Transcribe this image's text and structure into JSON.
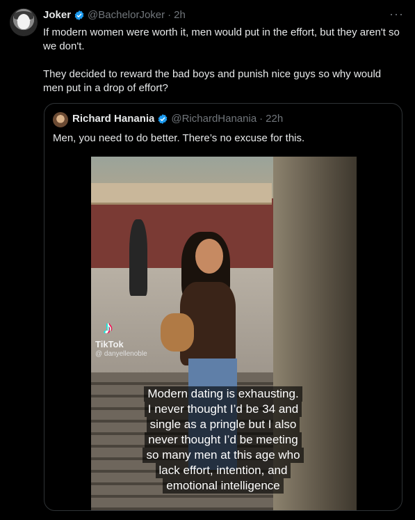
{
  "tweet": {
    "author_name": "Joker",
    "author_handle": "@BachelorJoker",
    "separator": "·",
    "time": "2h",
    "more_label": "···",
    "text_p1": "If modern women were worth it, men would put in the effort, but they aren't so we don't.",
    "text_p2": "They decided to reward the bad boys and punish nice guys so why would men put in a drop of effort?"
  },
  "quoted_tweet": {
    "author_name": "Richard Hanania",
    "author_handle": "@RichardHanania",
    "separator": "·",
    "time": "22h",
    "text": "Men, you need to do better. There’s no excuse for this.",
    "video": {
      "tiktok_logo": "♪",
      "tiktok_name": "TikTok",
      "tiktok_user": "@ danyellenoble",
      "caption_lines": [
        "Modern dating is exhausting.",
        "I never thought I’d be 34 and",
        "single as a pringle but I also",
        "never thought I’d be meeting",
        "so many men at this age who",
        "lack effort, intention, and",
        "emotional intelligence"
      ]
    }
  },
  "colors": {
    "background": "#000000",
    "text": "#e7e9ea",
    "secondary_text": "#71767b",
    "verified_badge": "#1d9bf0",
    "border": "#2f3336"
  },
  "icons": {
    "verified": "verified-badge-icon",
    "more": "more-icon"
  }
}
